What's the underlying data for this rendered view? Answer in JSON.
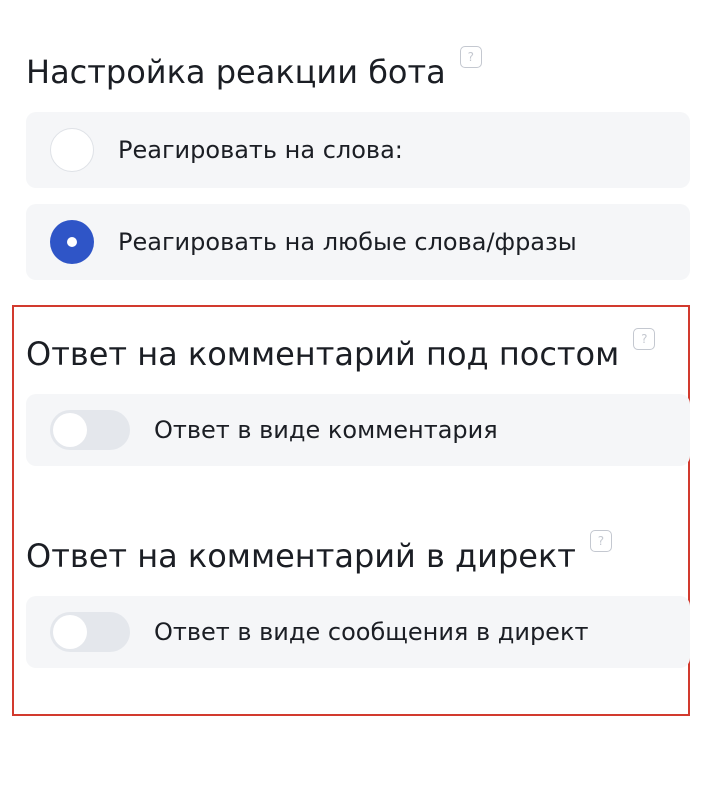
{
  "bot_reaction": {
    "title": "Настройка реакции бота",
    "help_glyph": "?",
    "options": [
      {
        "label": "Реагировать на слова:",
        "selected": false
      },
      {
        "label": "Реагировать на любые слова/фразы",
        "selected": true
      }
    ]
  },
  "comment_reply": {
    "title": "Ответ на комментарий под постом",
    "help_glyph": "?",
    "toggle_label": "Ответ в виде комментария",
    "toggle_on": false
  },
  "direct_reply": {
    "title": "Ответ на комментарий в директ",
    "help_glyph": "?",
    "toggle_label": "Ответ в виде сообщения в директ",
    "toggle_on": false
  },
  "colors": {
    "accent": "#2f55c7",
    "row_background": "#f5f6f8",
    "toggle_off": "#e4e7ec",
    "highlight_border": "#d23a2e"
  },
  "icons": {
    "help": "help-icon",
    "radio_off": "radio-unselected-icon",
    "radio_on": "radio-selected-icon"
  }
}
